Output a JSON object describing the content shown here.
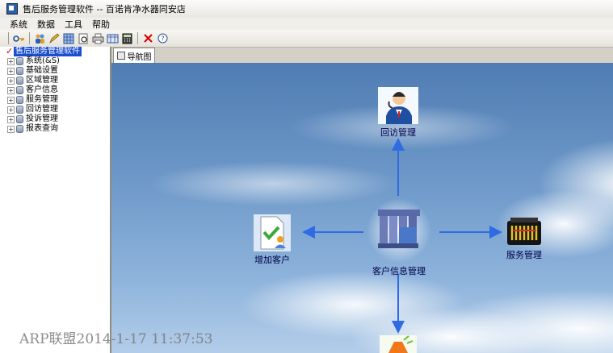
{
  "window": {
    "title": "售后服务管理软件 -- 百诺肯净水器同安店"
  },
  "menu": [
    "系统",
    "数据",
    "工具",
    "帮助"
  ],
  "toolbar_icons": [
    "key-icon",
    "people-icon",
    "pencil-icon",
    "grid-icon",
    "preview-icon",
    "print-icon",
    "table-icon",
    "calculator-icon",
    "close-icon",
    "help-icon"
  ],
  "tree": {
    "root": "售后服务管理软件",
    "items": [
      "系统(&S)",
      "基础设置",
      "区域管理",
      "客户信息",
      "服务管理",
      "回访管理",
      "投诉管理",
      "报表查询"
    ]
  },
  "tab": {
    "label": "导航图"
  },
  "nav": {
    "followup": "回访管理",
    "center": "客户信息管理",
    "add_customer": "增加客户",
    "service": "服务管理"
  },
  "colors": {
    "arrow": "#2f6be3",
    "root_highlight": "#1a4fd0"
  },
  "watermark": "ARP联盟2014-1-17 11:37:53"
}
